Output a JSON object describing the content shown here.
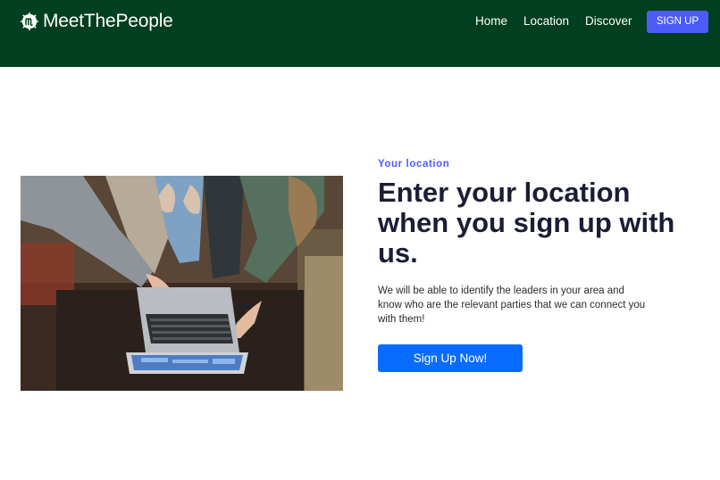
{
  "navbar": {
    "brand": "MeetThePeople",
    "brand_icon": "brand-logo-icon",
    "links": [
      "Home",
      "Location",
      "Discover"
    ],
    "signup_label": "SIGN UP",
    "colors": {
      "background": "#003f1f",
      "signup_button": "#4d5bf9"
    }
  },
  "hero": {
    "eyebrow": "Your location",
    "headline": "Enter your location when you sign up with us.",
    "body": "We will be able to identify the leaders in your area and know who are the relevant parties that we can connect you with them!",
    "cta_label": "Sign Up Now!",
    "image_subject": "people-pointing-at-laptop",
    "colors": {
      "eyebrow": "#4d5bf9",
      "headline": "#1b1d35",
      "cta": "#0a6cff"
    }
  }
}
